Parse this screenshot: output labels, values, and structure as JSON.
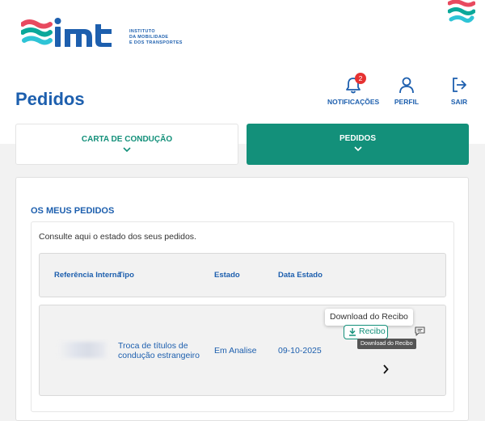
{
  "brand": {
    "name": "imt",
    "tagline": [
      "INSTITUTO",
      "DA MOBILIDADE",
      "E DOS TRANSPORTES"
    ],
    "colors": {
      "primary": "#1d5fae",
      "accent": "#13907a",
      "badge": "#e63232"
    }
  },
  "page": {
    "title": "Pedidos"
  },
  "nav": {
    "notificacoes": {
      "label": "NOTIFICAÇÕES",
      "count": "2",
      "icon": "bell-icon"
    },
    "perfil": {
      "label": "PERFIL",
      "icon": "user-icon"
    },
    "sair": {
      "label": "SAIR",
      "icon": "logout-icon"
    }
  },
  "tabs": [
    {
      "label": "CARTA DE CONDUÇÃO",
      "active": false
    },
    {
      "label": "PEDIDOS",
      "active": true
    }
  ],
  "section": {
    "title": "OS MEUS PEDIDOS",
    "hint": "Consulte aqui o estado dos seus pedidos."
  },
  "table": {
    "headers": [
      "Referência Interna",
      "Tipo",
      "Estado",
      "Data Estado"
    ],
    "rows": [
      {
        "referencia": "",
        "tipo": "Troca de títulos de condução estrangeiro",
        "estado": "Em Analise",
        "data": "09-10-2025",
        "recibo_label": "Recibo",
        "tooltip": "Download do Recibo"
      }
    ]
  }
}
